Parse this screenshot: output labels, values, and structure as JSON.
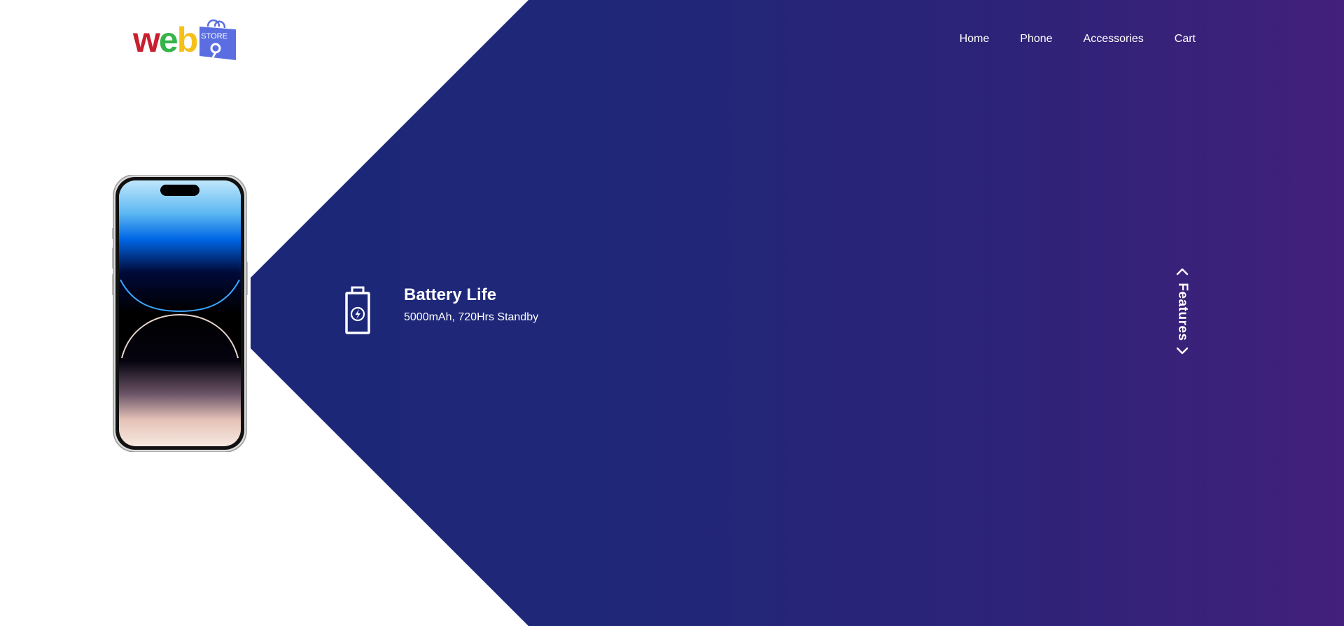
{
  "brand": {
    "logo_letters": [
      "w",
      "e",
      "b"
    ],
    "logo_letter_colors": [
      "#c8202f",
      "#35b44a",
      "#f5c018"
    ],
    "bag_text": "STORE",
    "bag_color": "#5b6ee1"
  },
  "nav": {
    "items": [
      {
        "label": "Home"
      },
      {
        "label": "Phone"
      },
      {
        "label": "Accessories"
      },
      {
        "label": "Cart"
      }
    ]
  },
  "hero": {
    "gradient_colors": [
      "#1a2779",
      "#42207b"
    ]
  },
  "feature": {
    "icon": "battery-charging-icon",
    "title": "Battery Life",
    "subtitle": "5000mAh, 720Hrs Standby"
  },
  "side_nav": {
    "label": "Features",
    "up_icon": "chevron-up-icon",
    "down_icon": "chevron-down-icon"
  },
  "product_image": {
    "icon": "smartphone-image"
  }
}
